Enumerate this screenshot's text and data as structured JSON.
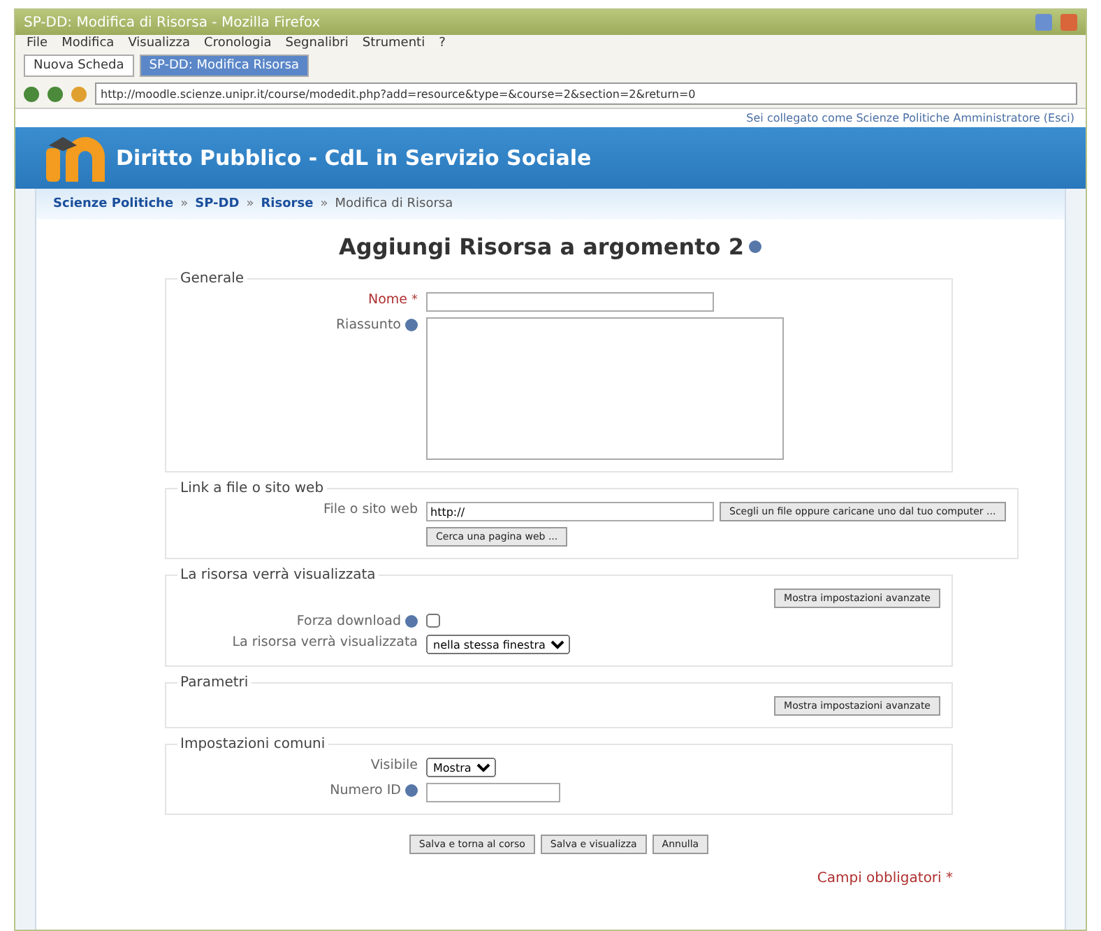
{
  "window": {
    "title": "SP-DD: Modifica di Risorsa - Mozilla Firefox"
  },
  "menu": [
    "File",
    "Modifica",
    "Visualizza",
    "Cronologia",
    "Segnalibri",
    "Strumenti",
    "?"
  ],
  "tabs": [
    {
      "label": "Nuova Scheda",
      "selected": false
    },
    {
      "label": "SP-DD: Modifica Risorsa",
      "selected": true
    }
  ],
  "address": {
    "value": "http://moodle.scienze.unipr.it/course/modedit.php?add=resource&type=&course=2&section=2&return=0"
  },
  "login_info": "Sei collegato come Scienze Politiche Amministratore (Esci)",
  "site_title": "Diritto Pubblico - CdL in Servizio Sociale",
  "breadcrumb": {
    "separator": "»",
    "items": [
      "Scienze Politiche",
      "SP-DD",
      "Risorse",
      "Modifica di Risorsa"
    ]
  },
  "page_title": "Aggiungi Risorsa a argomento 2",
  "sections": [
    {
      "legend": "Generale",
      "fields": [
        {
          "kind": "text",
          "label": "Nome",
          "required_mark": "*"
        },
        {
          "kind": "textarea",
          "label": "Riassunto",
          "help": true
        }
      ]
    },
    {
      "legend": "Link a file o sito web",
      "fields": [
        {
          "kind": "file",
          "label": "File o sito web",
          "value": "http://",
          "buttons": [
            "Scegli un file oppure caricane uno dal tuo computer ...",
            "Cerca una pagina web ..."
          ]
        }
      ]
    },
    {
      "legend": "La risorsa verrà visualizzata",
      "advanced_button": "Mostra impostazioni avanzate",
      "fields": [
        {
          "kind": "checkbox",
          "label": "Forza download",
          "help": true,
          "checked": false
        },
        {
          "kind": "select",
          "label": "La risorsa verrà visualizzata",
          "value": "nella stessa finestra"
        }
      ]
    },
    {
      "legend": "Parametri",
      "advanced_button": "Mostra impostazioni avanzate"
    },
    {
      "legend": "Impostazioni comuni",
      "fields": [
        {
          "kind": "select",
          "label": "Visibile",
          "value": "Mostra"
        },
        {
          "kind": "text",
          "label": "Numero ID",
          "help": true
        }
      ]
    }
  ],
  "actions": [
    "Salva e torna al corso",
    "Salva e visualizza",
    "Annulla"
  ],
  "required_note": "Campi obbligatori *"
}
